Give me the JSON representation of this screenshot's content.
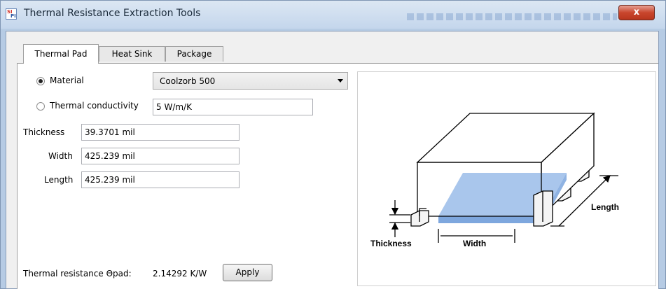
{
  "window": {
    "title": "Thermal Resistance Extraction Tools",
    "icon_text_top": "SI",
    "icon_text_bottom": "PI",
    "close_label": "x"
  },
  "tabs": [
    {
      "label": "Thermal Pad",
      "active": true
    },
    {
      "label": "Heat Sink",
      "active": false
    },
    {
      "label": "Package",
      "active": false
    }
  ],
  "thermal_pad": {
    "material": {
      "label": "Material",
      "selected": true,
      "value": "Coolzorb 500"
    },
    "conductivity": {
      "label": "Thermal conductivity",
      "selected": false,
      "value": "5 W/m/K"
    },
    "thickness": {
      "label": "Thickness",
      "value": "39.3701 mil"
    },
    "width": {
      "label": "Width",
      "value": "425.239 mil"
    },
    "length": {
      "label": "Length",
      "value": "425.239 mil"
    },
    "result": {
      "label": "Thermal resistance Θpad:",
      "value": "2.14292 K/W"
    },
    "apply_label": "Apply"
  },
  "diagram": {
    "thickness_label": "Thickness",
    "width_label": "Width",
    "length_label": "Length",
    "pad_color": "#9dbbe3"
  }
}
